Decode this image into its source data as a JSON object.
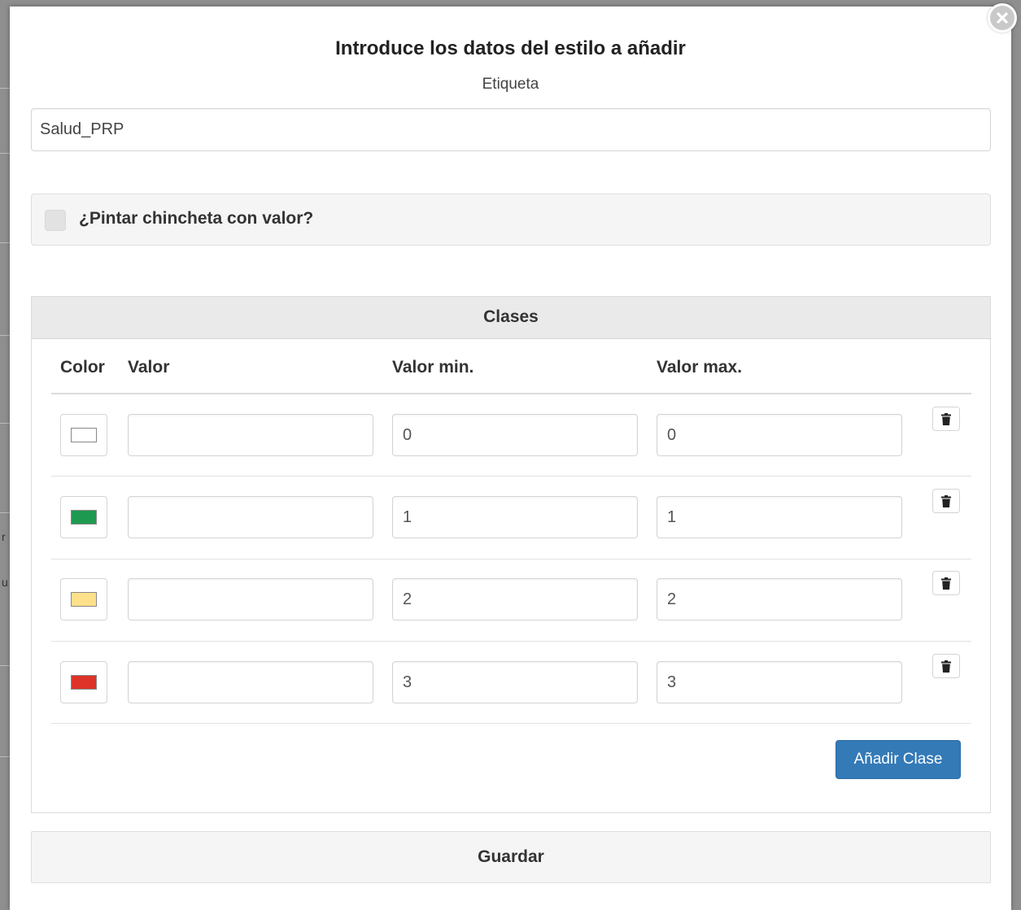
{
  "background": {
    "side_letters": [
      "r",
      "u"
    ]
  },
  "dialog": {
    "title": "Introduce los datos del estilo a añadir",
    "label_caption": "Etiqueta",
    "label_value": "Salud_PRP",
    "pin_checkbox_label": "¿Pintar chincheta con valor?",
    "pin_checkbox_checked": false,
    "classes_title": "Clases",
    "columns": {
      "color": "Color",
      "valor": "Valor",
      "min": "Valor min.",
      "max": "Valor max."
    },
    "rows": [
      {
        "color": "#ffffff",
        "valor": "",
        "min": "0",
        "max": "0"
      },
      {
        "color": "#1e9a50",
        "valor": "",
        "min": "1",
        "max": "1"
      },
      {
        "color": "#ffe08a",
        "valor": "",
        "min": "2",
        "max": "2"
      },
      {
        "color": "#dd3328",
        "valor": "",
        "min": "3",
        "max": "3"
      }
    ],
    "add_class_label": "Añadir Clase",
    "save_label": "Guardar"
  }
}
